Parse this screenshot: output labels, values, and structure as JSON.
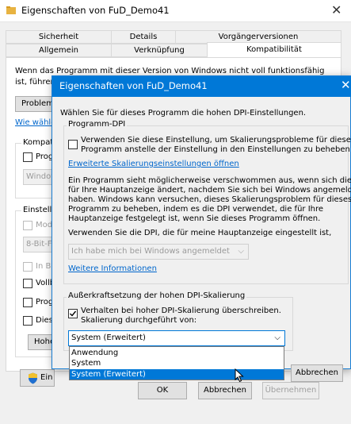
{
  "back_window": {
    "title": "Eigenschaften von FuD_Demo41",
    "close": "✕",
    "tabs_row1": [
      "Sicherheit",
      "Details",
      "Vorgängerversionen"
    ],
    "tabs_row2": [
      "Allgemein",
      "Verknüpfung",
      "Kompatibilität"
    ],
    "intro_line1": "Wenn das Programm mit dieser Version von Windows nicht voll funktionsfähig",
    "intro_line2": "ist, führen",
    "problem_button": "Problem",
    "link_partial": "Wie wähle",
    "group_compat_label": "Kompati",
    "prog_label": "Prog",
    "windows_combo": "Window",
    "group_settings_label": "Einstellu",
    "mode_label": "Mod",
    "color_combo": "8-Bit-Fa",
    "in_bi_label": "In Bi",
    "vollb_label": "Vollb",
    "prog2_label": "Prog",
    "dies_label": "Dies",
    "hohe_button": "Hohe",
    "ein_button": "Ein",
    "ok": "OK",
    "cancel": "Abbrechen",
    "apply": "Übernehmen"
  },
  "dialog": {
    "title": "Eigenschaften von FuD_Demo41",
    "close": "✕",
    "heading": "Wählen Sie für dieses Programm die hohen DPI-Einstellungen.",
    "group1_label": "Programm-DPI",
    "chk1_line1": "Verwenden Sie diese Einstellung, um Skalierungsprobleme für dieses",
    "chk1_line2": "Programm anstelle der Einstellung in den Einstellungen zu beheben",
    "link_advanced": "Erweiterte Skalierungseinstellungen öffnen",
    "para_lines": [
      "Ein Programm sieht möglicherweise verschwommen aus, wenn sich die DPI",
      "für Ihre Hauptanzeige ändert, nachdem Sie sich bei Windows angemeldet",
      "haben. Windows kann versuchen, dieses Skalierungsproblem für dieses",
      "Programm zu beheben, indem es die DPI verwendet, die für Ihre",
      "Hauptanzeige festgelegt ist, wenn Sie dieses Programm öffnen."
    ],
    "use_dpi_label": "Verwenden Sie die DPI, die für meine Hauptanzeige eingestellt ist,",
    "login_combo": "Ich habe mich bei Windows angemeldet",
    "link_more": "Weitere Informationen",
    "group2_label": "Außerkraftsetzung der hohen DPI-Skalierung",
    "chk2_line1": "Verhalten bei hoher DPI-Skalierung überschreiben.",
    "chk2_line2": "Skalierung durchgeführt von:",
    "scaling_combo": "System (Erweitert)",
    "dropdown_options": [
      "Anwendung",
      "System",
      "System (Erweitert)"
    ],
    "cancel": "Abbrechen"
  }
}
